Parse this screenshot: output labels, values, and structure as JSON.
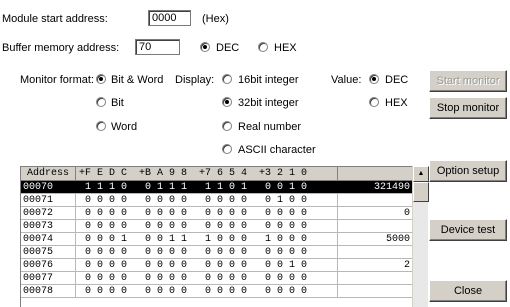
{
  "module_start": {
    "label": "Module start address:",
    "value": "0000",
    "unit": "(Hex)"
  },
  "buffer_memory": {
    "label": "Buffer memory address:",
    "value": "70",
    "options": [
      "DEC",
      "HEX"
    ],
    "selected": "DEC"
  },
  "monitor_format": {
    "label": "Monitor format:",
    "options": [
      "Bit & Word",
      "Bit",
      "Word"
    ],
    "selected": "Bit & Word"
  },
  "display": {
    "label": "Display:",
    "options": [
      "16bit integer",
      "32bit integer",
      "Real number",
      "ASCII character"
    ],
    "selected": "32bit integer"
  },
  "value_format": {
    "label": "Value:",
    "options": [
      "DEC",
      "HEX"
    ],
    "selected": "DEC"
  },
  "buttons": {
    "start_monitor": "Start monitor",
    "stop_monitor": "Stop monitor",
    "option_setup": "Option setup",
    "device_test": "Device test",
    "close": "Close"
  },
  "table": {
    "headers": {
      "address": "Address",
      "bits": "+F E D C  +B A 9 8  +7 6 5 4  +3 2 1 0",
      "value": ""
    },
    "rows": [
      {
        "address": "00070",
        "bits": " 1 1 1 0   0 1 1 1   1 1 0 1   0 0 1 0",
        "value": "321490",
        "selected": true
      },
      {
        "address": "00071",
        "bits": " 0 0 0 0   0 0 0 0   0 0 0 0   0 1 0 0",
        "value": ""
      },
      {
        "address": "00072",
        "bits": " 0 0 0 0   0 0 0 0   0 0 0 0   0 0 0 0",
        "value": "0"
      },
      {
        "address": "00073",
        "bits": " 0 0 0 0   0 0 0 0   0 0 0 0   0 0 0 0",
        "value": ""
      },
      {
        "address": "00074",
        "bits": " 0 0 0 1   0 0 1 1   1 0 0 0   1 0 0 0",
        "value": "5000"
      },
      {
        "address": "00075",
        "bits": " 0 0 0 0   0 0 0 0   0 0 0 0   0 0 0 0",
        "value": ""
      },
      {
        "address": "00076",
        "bits": " 0 0 0 0   0 0 0 0   0 0 0 0   0 0 1 0",
        "value": "2"
      },
      {
        "address": "00077",
        "bits": " 0 0 0 0   0 0 0 0   0 0 0 0   0 0 0 0",
        "value": ""
      },
      {
        "address": "00078",
        "bits": " 0 0 0 0   0 0 0 0   0 0 0 0   0 0 0 0",
        "value": ""
      }
    ]
  },
  "icons": {
    "scroll_up": "up-arrow-icon"
  }
}
